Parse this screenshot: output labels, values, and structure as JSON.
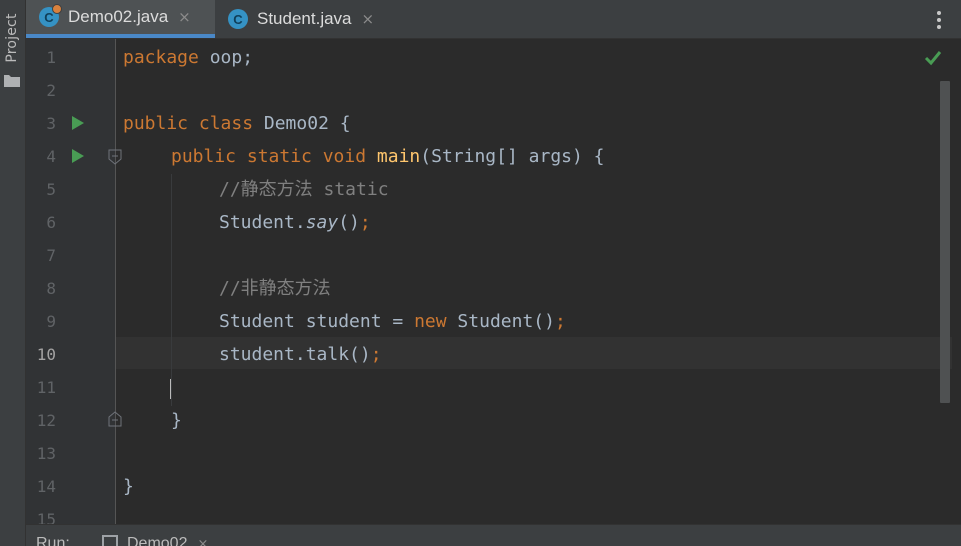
{
  "tool_strip": {
    "project_label": "Project",
    "folder_icon": "folder-icon"
  },
  "tabs": [
    {
      "name": "Demo02.java",
      "icon": "java-class-icon",
      "close": "×",
      "active": true
    },
    {
      "name": "Student.java",
      "icon": "java-class-icon",
      "close": "×",
      "active": false
    }
  ],
  "tab_icon_letter": "C",
  "editor": {
    "current_line": 10,
    "line_numbers": [
      "1",
      "2",
      "3",
      "4",
      "5",
      "6",
      "7",
      "8",
      "9",
      "10",
      "11",
      "12",
      "13",
      "14",
      "15"
    ],
    "code": {
      "l1_kw": "package",
      "l1_rest": " oop;",
      "l3_kw": "public class",
      "l3_rest": " Demo02 {",
      "l4_kw": "public static void",
      "l4_fn": "main",
      "l4_rest": "(String[] args) {",
      "l5_comment": "//静态方法 static",
      "l6_obj": "Student.",
      "l6_method": "say",
      "l6_paren": "()",
      "l6_semi": ";",
      "l8_comment": "//非静态方法",
      "l9_a": "Student student = ",
      "l9_kw": "new",
      "l9_b": " Student()",
      "l9_semi": ";",
      "l10_a": "student.talk()",
      "l10_semi": ";",
      "l12_brace": "}",
      "l14_brace": "}"
    },
    "inspection_status": "ok-check-icon"
  },
  "run_bar": {
    "label": "Run:",
    "tab_name": "Demo02",
    "close": "×"
  },
  "colors": {
    "keyword": "#cc7832",
    "function": "#ffc66d",
    "comment": "#808080",
    "text": "#a9b7c6",
    "run_icon": "#499c54",
    "accent": "#4a88c7"
  }
}
